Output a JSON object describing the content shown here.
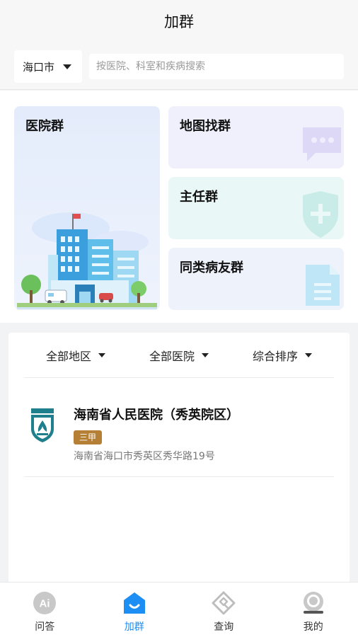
{
  "header": {
    "title": "加群"
  },
  "search": {
    "city": "海口市",
    "placeholder": "按医院、科室和疾病搜索"
  },
  "cards": {
    "hospital": "医院群",
    "map": "地图找群",
    "director": "主任群",
    "patient": "同类病友群"
  },
  "filters": [
    {
      "label": "全部地区"
    },
    {
      "label": "全部医院"
    },
    {
      "label": "综合排序"
    }
  ],
  "hospital": {
    "name": "海南省人民医院（秀英院区）",
    "grade": "三甲",
    "address": "海南省海口市秀英区秀华路19号"
  },
  "tabs": [
    {
      "label": "问答",
      "icon": "ai-icon",
      "active": false
    },
    {
      "label": "加群",
      "icon": "add-group-icon",
      "active": true
    },
    {
      "label": "查询",
      "icon": "query-icon",
      "active": false
    },
    {
      "label": "我的",
      "icon": "profile-icon",
      "active": false
    }
  ],
  "colors": {
    "accent": "#1c8ef4",
    "badge": "#b58036",
    "logo": "#1f7f8c"
  }
}
